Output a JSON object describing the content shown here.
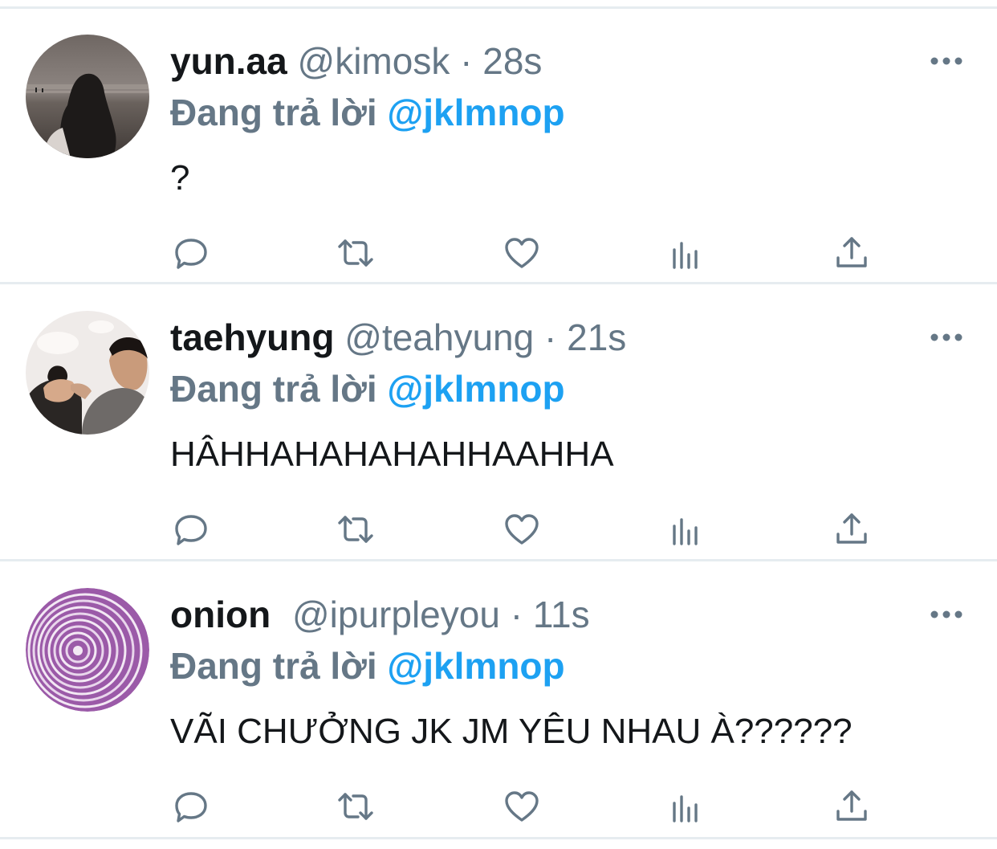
{
  "colors": {
    "primary_text": "#14171a",
    "secondary_text": "#657786",
    "accent": "#1da1f2",
    "divider": "#e6ecf0"
  },
  "actions": [
    {
      "icon": "reply-icon"
    },
    {
      "icon": "retweet-icon"
    },
    {
      "icon": "like-icon"
    },
    {
      "icon": "analytics-icon"
    },
    {
      "icon": "share-icon"
    }
  ],
  "tweets": [
    {
      "display_name": "yun.aa",
      "handle": "@kimosk",
      "separator": "·",
      "time": "28s",
      "reply_prefix": "Đang trả lời",
      "reply_to": "@jklmnop",
      "text": "?",
      "avatar": "beach-silhouette-photo"
    },
    {
      "display_name": "taehyung",
      "handle": "@teahyung",
      "separator": "·",
      "time": "21s",
      "reply_prefix": "Đang trả lời",
      "reply_to": "@jklmnop",
      "text": "HÂHHAHAHAHAHHAAHHA",
      "avatar": "people-heart-hands-photo"
    },
    {
      "display_name": "onion",
      "handle": "@ipurpleyou",
      "separator": "·",
      "time": "11s",
      "reply_prefix": "Đang trả lời",
      "reply_to": "@jklmnop",
      "text": "VÃI CHƯỞNG JK JM YÊU NHAU À??????",
      "avatar": "red-onion-slice-photo"
    }
  ]
}
